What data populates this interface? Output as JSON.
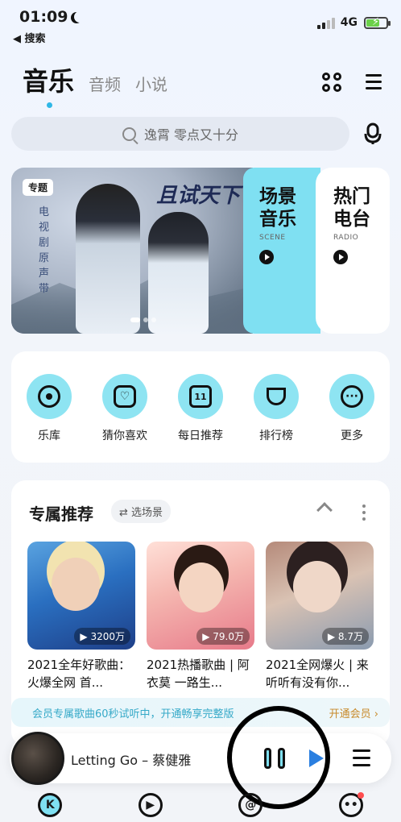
{
  "status_bar": {
    "time": "01:09",
    "back_app": "◀ 搜索",
    "network": "4G"
  },
  "header": {
    "tabs": [
      {
        "label": "音乐",
        "active": true
      },
      {
        "label": "音频",
        "active": false
      },
      {
        "label": "小说",
        "active": false
      }
    ]
  },
  "search": {
    "placeholder": "逸霄 零点又十分"
  },
  "banner": {
    "tag": "专题",
    "vertical_text": "电视剧原声带",
    "title": "且试天下",
    "scene": {
      "title": "场景音乐",
      "sub": "SCENE"
    },
    "radio": {
      "title": "热门电台",
      "sub": "RADIO"
    }
  },
  "quick_nav": [
    {
      "label": "乐库",
      "icon": "disc-icon"
    },
    {
      "label": "猜你喜欢",
      "icon": "heart-icon"
    },
    {
      "label": "每日推荐",
      "icon": "calendar-icon",
      "glyph": "11"
    },
    {
      "label": "排行榜",
      "icon": "trophy-icon"
    },
    {
      "label": "更多",
      "icon": "more-icon"
    }
  ],
  "recommend": {
    "title": "专属推荐",
    "scene_button": "⇄ 选场景",
    "cards": [
      {
        "count": "▶ 3200万",
        "title": "2021全年好歌曲：火爆全网 首..."
      },
      {
        "count": "▶ 79.0万",
        "title": "2021热播歌曲 | 阿衣莫 一路生..."
      },
      {
        "count": "▶ 8.7万",
        "title": "2021全网爆火 | 来听听有没有你..."
      }
    ]
  },
  "vip_bar": {
    "text": "会员专属歌曲60秒试听中，开通畅享完整版",
    "cta": "开通会员 ›"
  },
  "player": {
    "song": "Letting Go – 蔡健雅"
  },
  "bottom_nav": [
    {
      "name": "home",
      "glyph": "K"
    },
    {
      "name": "video",
      "glyph": "▶"
    },
    {
      "name": "community",
      "glyph": "@"
    },
    {
      "name": "profile",
      "glyph": "••"
    }
  ],
  "colors": {
    "accent": "#7fe0f2",
    "tab_dot": "#2fb7e6",
    "vip_text": "#36a9c8",
    "vip_cta": "#c88a2a"
  }
}
